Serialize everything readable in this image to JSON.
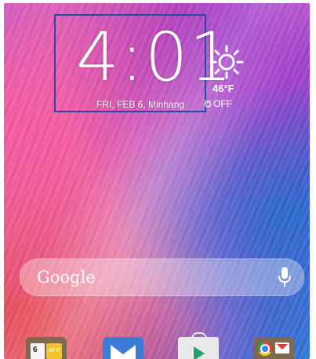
{
  "clock": {
    "hours": "4",
    "separator": ":",
    "minutes": "01",
    "date_location": "FRI, FEB 6, Minhang"
  },
  "weather": {
    "icon": "sun-icon",
    "temperature": "46°F"
  },
  "alarm": {
    "icon": "alarm-icon",
    "status": "OFF"
  },
  "search": {
    "logo_text": "Google",
    "mic_icon": "mic-icon"
  },
  "dock": {
    "apps": [
      {
        "icon": "calendar-weather-icon",
        "date": "6",
        "temp": "46°F"
      },
      {
        "icon": "email-icon"
      },
      {
        "icon": "play-store-icon"
      },
      {
        "icon": "chrome-gmail-folder-icon"
      }
    ]
  },
  "colors": {
    "widget_border": "#2a4aa0",
    "wallpaper_pink": "#e86fb0",
    "wallpaper_purple": "#8a3fc8",
    "wallpaper_blue": "#2f7ad8",
    "wallpaper_red": "#eb4646"
  }
}
